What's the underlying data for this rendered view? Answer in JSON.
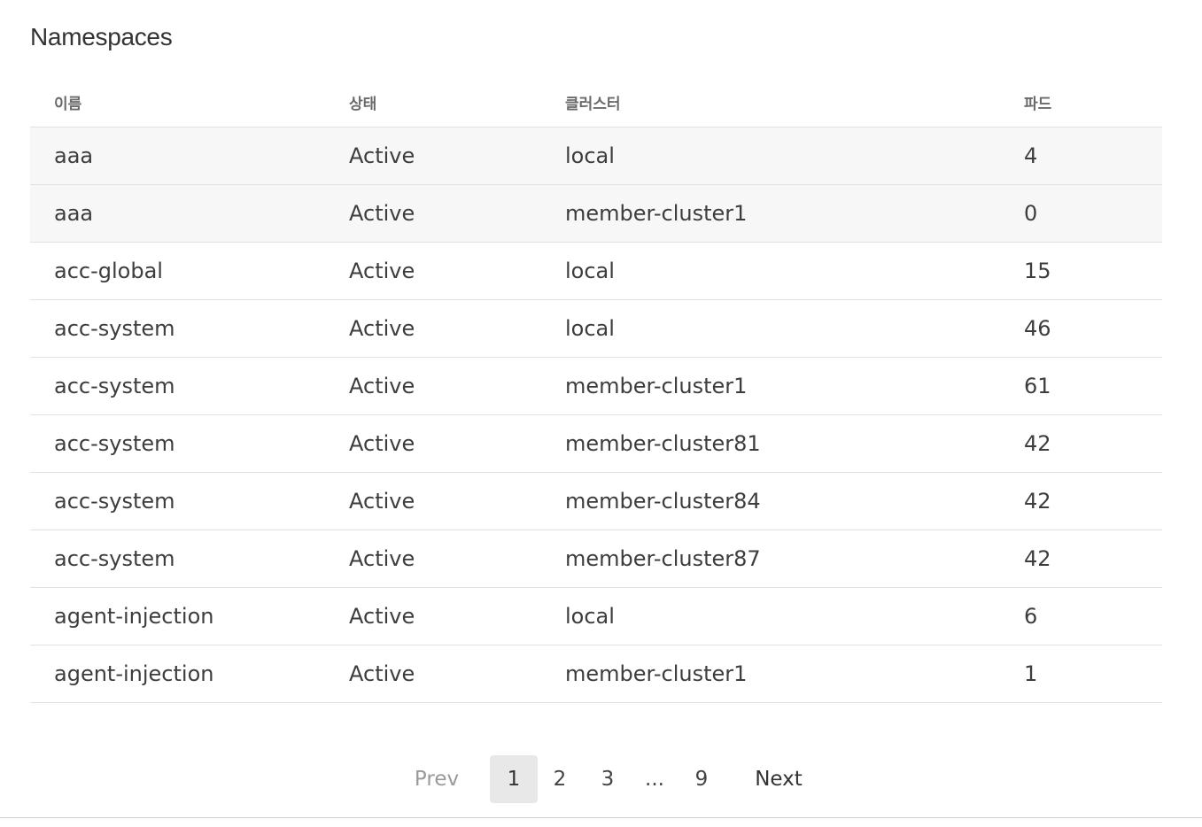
{
  "page": {
    "title": "Namespaces"
  },
  "table": {
    "headers": {
      "name": "이름",
      "status": "상태",
      "cluster": "클러스터",
      "pods": "파드"
    },
    "rows": [
      {
        "name": "aaa",
        "status": "Active",
        "cluster": "local",
        "pods": "4"
      },
      {
        "name": "aaa",
        "status": "Active",
        "cluster": "member-cluster1",
        "pods": "0"
      },
      {
        "name": "acc-global",
        "status": "Active",
        "cluster": "local",
        "pods": "15"
      },
      {
        "name": "acc-system",
        "status": "Active",
        "cluster": "local",
        "pods": "46"
      },
      {
        "name": "acc-system",
        "status": "Active",
        "cluster": "member-cluster1",
        "pods": "61"
      },
      {
        "name": "acc-system",
        "status": "Active",
        "cluster": "member-cluster81",
        "pods": "42"
      },
      {
        "name": "acc-system",
        "status": "Active",
        "cluster": "member-cluster84",
        "pods": "42"
      },
      {
        "name": "acc-system",
        "status": "Active",
        "cluster": "member-cluster87",
        "pods": "42"
      },
      {
        "name": "agent-injection",
        "status": "Active",
        "cluster": "local",
        "pods": "6"
      },
      {
        "name": "agent-injection",
        "status": "Active",
        "cluster": "member-cluster1",
        "pods": "1"
      }
    ]
  },
  "pagination": {
    "prev": "Prev",
    "pages": [
      "1",
      "2",
      "3"
    ],
    "ellipsis": "...",
    "last_page": "9",
    "next": "Next",
    "current": "1"
  }
}
